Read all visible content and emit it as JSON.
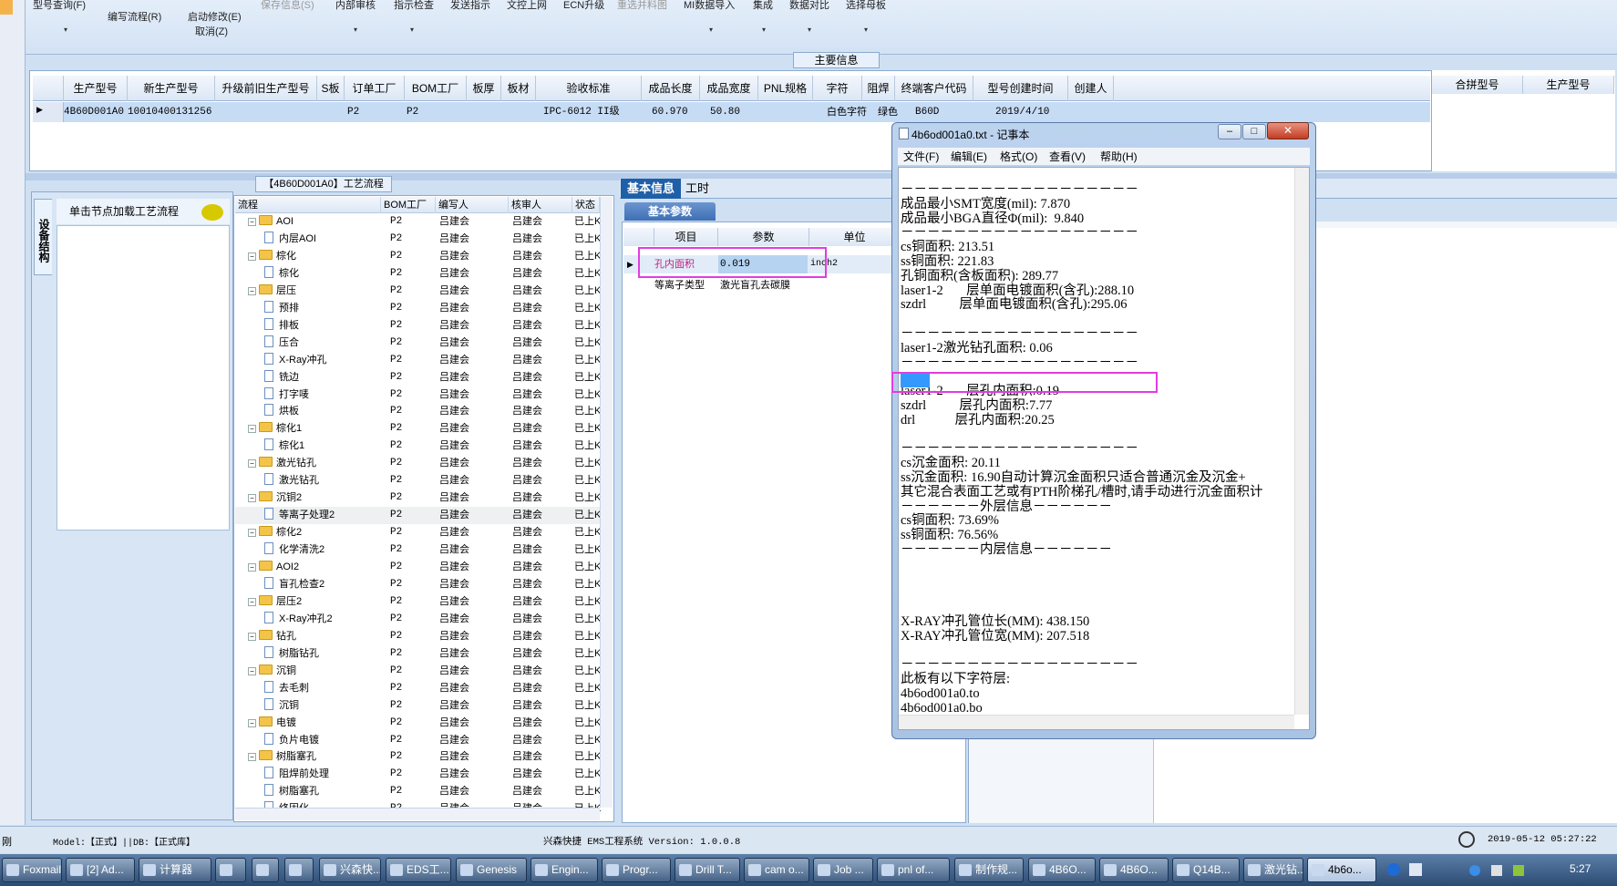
{
  "toolbar": {
    "items": [
      {
        "label": "型号查询(F)",
        "dim": false
      },
      {
        "label": "编写流程(R)",
        "dim": false
      },
      {
        "label": "启动修改(E)",
        "dim": false
      },
      {
        "label": "保存信息(S)",
        "dim": true
      },
      {
        "label": "内部审核",
        "dim": false
      },
      {
        "label": "指示检查",
        "dim": false
      },
      {
        "label": "发送指示",
        "dim": false
      },
      {
        "label": "文控上网",
        "dim": false
      },
      {
        "label": "ECN升级",
        "dim": false
      },
      {
        "label": "重选并料图",
        "dim": true
      },
      {
        "label": "MI数据导入",
        "dim": false
      },
      {
        "label": "集成",
        "dim": false
      },
      {
        "label": "数据对比",
        "dim": false
      },
      {
        "label": "选择母板",
        "dim": false
      }
    ],
    "cancel_label": "取消(Z)"
  },
  "main_info": {
    "title": "主要信息",
    "columns": [
      "生产型号",
      "新生产型号",
      "升级前旧生产型号",
      "S板",
      "订单工厂",
      "BOM工厂",
      "板厚",
      "板材",
      "验收标准",
      "成品长度",
      "成品宽度",
      "PNL规格",
      "字符",
      "阻焊",
      "终端客户代码",
      "型号创建时间",
      "创建人"
    ],
    "row": [
      "4B60D001A0",
      "10010400131256",
      "",
      "",
      "P2",
      "P2",
      "",
      "",
      "IPC-6012 II级",
      "60.970",
      "50.80",
      "",
      "白色字符",
      "绿色",
      "B60D",
      "2019/4/10",
      ""
    ],
    "merge_columns": [
      "合拼型号",
      "生产型号"
    ]
  },
  "left_panel": {
    "vertical_tab": "设备结构",
    "hint": "单击节点加载工艺流程"
  },
  "flow": {
    "title": "【4B60D001A0】工艺流程",
    "columns": [
      "流程",
      "BOM工厂",
      "编写人",
      "核审人",
      "状态"
    ],
    "rows": [
      {
        "level": 0,
        "name": "AOI",
        "factory": "P2",
        "writer": "吕建会",
        "reviewer": "吕建会",
        "status": "已上K"
      },
      {
        "level": 1,
        "name": "内层AOI",
        "factory": "P2",
        "writer": "吕建会",
        "reviewer": "吕建会",
        "status": "已上K"
      },
      {
        "level": 0,
        "name": "棕化",
        "factory": "P2",
        "writer": "吕建会",
        "reviewer": "吕建会",
        "status": "已上K"
      },
      {
        "level": 1,
        "name": "棕化",
        "factory": "P2",
        "writer": "吕建会",
        "reviewer": "吕建会",
        "status": "已上K"
      },
      {
        "level": 0,
        "name": "层压",
        "factory": "P2",
        "writer": "吕建会",
        "reviewer": "吕建会",
        "status": "已上K"
      },
      {
        "level": 1,
        "name": "预排",
        "factory": "P2",
        "writer": "吕建会",
        "reviewer": "吕建会",
        "status": "已上K"
      },
      {
        "level": 1,
        "name": "排板",
        "factory": "P2",
        "writer": "吕建会",
        "reviewer": "吕建会",
        "status": "已上K"
      },
      {
        "level": 1,
        "name": "压合",
        "factory": "P2",
        "writer": "吕建会",
        "reviewer": "吕建会",
        "status": "已上K"
      },
      {
        "level": 1,
        "name": "X-Ray冲孔",
        "factory": "P2",
        "writer": "吕建会",
        "reviewer": "吕建会",
        "status": "已上K"
      },
      {
        "level": 1,
        "name": "铣边",
        "factory": "P2",
        "writer": "吕建会",
        "reviewer": "吕建会",
        "status": "已上K"
      },
      {
        "level": 1,
        "name": "打字唛",
        "factory": "P2",
        "writer": "吕建会",
        "reviewer": "吕建会",
        "status": "已上K"
      },
      {
        "level": 1,
        "name": "烘板",
        "factory": "P2",
        "writer": "吕建会",
        "reviewer": "吕建会",
        "status": "已上K"
      },
      {
        "level": 0,
        "name": "棕化1",
        "factory": "P2",
        "writer": "吕建会",
        "reviewer": "吕建会",
        "status": "已上K"
      },
      {
        "level": 1,
        "name": "棕化1",
        "factory": "P2",
        "writer": "吕建会",
        "reviewer": "吕建会",
        "status": "已上K"
      },
      {
        "level": 0,
        "name": "激光钻孔",
        "factory": "P2",
        "writer": "吕建会",
        "reviewer": "吕建会",
        "status": "已上K"
      },
      {
        "level": 1,
        "name": "激光钻孔",
        "factory": "P2",
        "writer": "吕建会",
        "reviewer": "吕建会",
        "status": "已上K"
      },
      {
        "level": 0,
        "name": "沉铜2",
        "factory": "P2",
        "writer": "吕建会",
        "reviewer": "吕建会",
        "status": "已上K"
      },
      {
        "level": 1,
        "name": "等离子处理2",
        "factory": "P2",
        "writer": "吕建会",
        "reviewer": "吕建会",
        "status": "已上K"
      },
      {
        "level": 0,
        "name": "棕化2",
        "factory": "P2",
        "writer": "吕建会",
        "reviewer": "吕建会",
        "status": "已上K"
      },
      {
        "level": 1,
        "name": "化学清洗2",
        "factory": "P2",
        "writer": "吕建会",
        "reviewer": "吕建会",
        "status": "已上K"
      },
      {
        "level": 0,
        "name": "AOI2",
        "factory": "P2",
        "writer": "吕建会",
        "reviewer": "吕建会",
        "status": "已上K"
      },
      {
        "level": 1,
        "name": "盲孔检查2",
        "factory": "P2",
        "writer": "吕建会",
        "reviewer": "吕建会",
        "status": "已上K"
      },
      {
        "level": 0,
        "name": "层压2",
        "factory": "P2",
        "writer": "吕建会",
        "reviewer": "吕建会",
        "status": "已上K"
      },
      {
        "level": 1,
        "name": "X-Ray冲孔2",
        "factory": "P2",
        "writer": "吕建会",
        "reviewer": "吕建会",
        "status": "已上K"
      },
      {
        "level": 0,
        "name": "钻孔",
        "factory": "P2",
        "writer": "吕建会",
        "reviewer": "吕建会",
        "status": "已上K"
      },
      {
        "level": 1,
        "name": "树脂钻孔",
        "factory": "P2",
        "writer": "吕建会",
        "reviewer": "吕建会",
        "status": "已上K"
      },
      {
        "level": 0,
        "name": "沉铜",
        "factory": "P2",
        "writer": "吕建会",
        "reviewer": "吕建会",
        "status": "已上K"
      },
      {
        "level": 1,
        "name": "去毛刺",
        "factory": "P2",
        "writer": "吕建会",
        "reviewer": "吕建会",
        "status": "已上K"
      },
      {
        "level": 1,
        "name": "沉铜",
        "factory": "P2",
        "writer": "吕建会",
        "reviewer": "吕建会",
        "status": "已上K"
      },
      {
        "level": 0,
        "name": "电镀",
        "factory": "P2",
        "writer": "吕建会",
        "reviewer": "吕建会",
        "status": "已上K"
      },
      {
        "level": 1,
        "name": "负片电镀",
        "factory": "P2",
        "writer": "吕建会",
        "reviewer": "吕建会",
        "status": "已上K"
      },
      {
        "level": 0,
        "name": "树脂塞孔",
        "factory": "P2",
        "writer": "吕建会",
        "reviewer": "吕建会",
        "status": "已上K"
      },
      {
        "level": 1,
        "name": "阻焊前处理",
        "factory": "P2",
        "writer": "吕建会",
        "reviewer": "吕建会",
        "status": "已上K"
      },
      {
        "level": 1,
        "name": "树脂塞孔",
        "factory": "P2",
        "writer": "吕建会",
        "reviewer": "吕建会",
        "status": "已上K"
      },
      {
        "level": 1,
        "name": "终固化",
        "factory": "P2",
        "writer": "吕建会",
        "reviewer": "吕建会",
        "status": "已上K"
      }
    ]
  },
  "basic_info": {
    "tab_active": "基本信息",
    "tab_other": "工时",
    "subtab": "基本参数",
    "columns": [
      "项目",
      "参数",
      "单位"
    ],
    "rows": [
      {
        "item": "孔内面积",
        "param": "0.019",
        "unit": "inch2"
      },
      {
        "item": "等离子类型",
        "param": "激光盲孔去碳膜",
        "unit": ""
      }
    ]
  },
  "notepad": {
    "title": "4b6od001a0.txt - 记事本",
    "menu": [
      "文件(F)",
      "编辑(E)",
      "格式(O)",
      "查看(V)",
      "帮助(H)"
    ],
    "lines": [
      "－－－－－－－－－－－－－－－－－－",
      "成品最小SMT宽度(mil): 7.870",
      "成品最小BGA直径Φ(mil):  9.840",
      "－－－－－－－－－－－－－－－－－－",
      "cs铜面积: 213.51",
      "ss铜面积: 221.83",
      "孔铜面积(含板面积): 289.77",
      "laser1-2       层单面电镀面积(含孔):288.10",
      "szdrl          层单面电镀面积(含孔):295.06",
      "",
      "－－－－－－－－－－－－－－－－－－",
      "laser1-2激光钻孔面积: 0.06",
      "－－－－－－－－－－－－－－－－－－",
      "",
      "laser1-2       层孔内面积:0.19",
      "szdrl          层孔内面积:7.77",
      "drl            层孔内面积:20.25",
      "",
      "－－－－－－－－－－－－－－－－－－",
      "cs沉金面积: 20.11",
      "ss沉金面积: 16.90自动计算沉金面积只适合普通沉金及沉金+",
      "其它混合表面工艺或有PTH阶梯孔/槽时,请手动进行沉金面积计",
      "－－－－－－外层信息－－－－－－",
      "cs铜面积: 73.69%",
      "ss铜面积: 76.56%",
      "－－－－－－内层信息－－－－－－",
      "",
      "",
      "",
      "",
      "X-RAY冲孔管位长(MM): 438.150",
      "X-RAY冲孔管位宽(MM): 207.518",
      "",
      "－－－－－－－－－－－－－－－－－－",
      "此板有以下字符层:",
      "4b6od001a0.to",
      "4b6od001a0.bo",
      "－－－－－－－－－－－－－－－－－－"
    ]
  },
  "status": {
    "left": "刚",
    "model": "Model:【正式】||DB:【正式库】",
    "system": "兴森快捷 EMS工程系统 Version: 1.0.0.8",
    "datetime": "2019-05-12 05:27:22"
  },
  "taskbar": {
    "items": [
      "Foxmail",
      "[2] Ad...",
      "计算器",
      "",
      "",
      "",
      "兴森快...",
      "EDS工...",
      "Genesis",
      "Engin...",
      "Progr...",
      "Drill T...",
      "cam o...",
      "Job ...",
      "pnl of...",
      "制作规...",
      "4B6O...",
      "4B6O...",
      "Q14B...",
      "激光钻...",
      "4b6o..."
    ],
    "clock": "5:27"
  },
  "colors": {
    "accent": "#1f5fa8",
    "highlight_box": "#e23ce0",
    "selected_row": "#c6dcf5"
  }
}
